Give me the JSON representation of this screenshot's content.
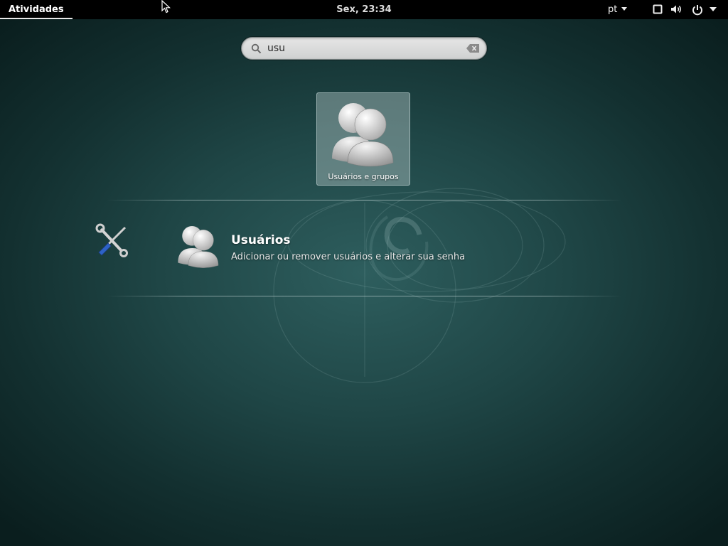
{
  "topbar": {
    "activities_label": "Atividades",
    "clock": "Sex, 23:34",
    "language": "pt",
    "icons": [
      "display-icon",
      "volume-icon",
      "power-icon",
      "menu-caret-icon"
    ]
  },
  "search": {
    "value": "usu",
    "placeholder": "",
    "icon": "search-icon",
    "clear_icon": "clear-icon"
  },
  "apps": [
    {
      "label": "Usuários e grupos",
      "icon": "users-icon"
    }
  ],
  "results": {
    "provider_icon": "settings-tools-icon",
    "items": [
      {
        "title": "Usuários",
        "description": "Adicionar ou remover usuários e alterar sua senha",
        "icon": "users-icon"
      }
    ]
  },
  "colors": {
    "topbar_bg": "#000000",
    "background": "#1f4646",
    "tile_highlight": "#a9bebe"
  }
}
